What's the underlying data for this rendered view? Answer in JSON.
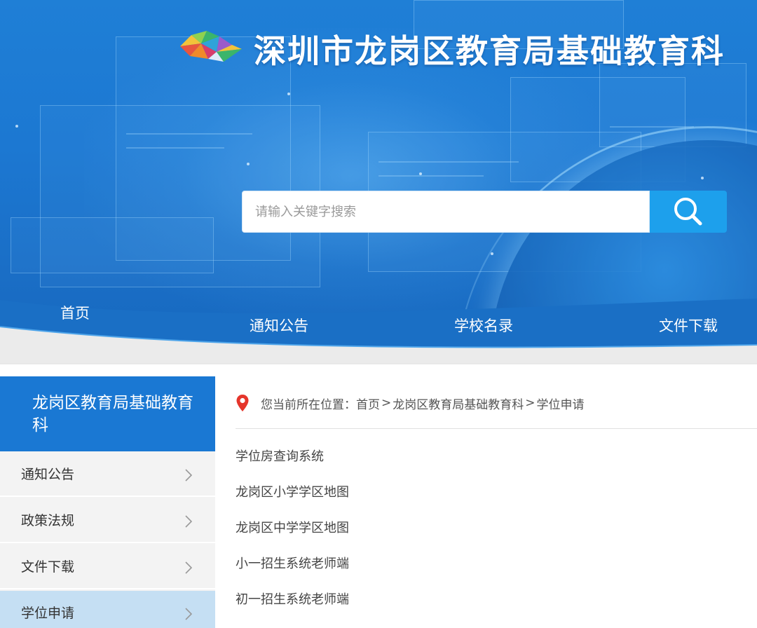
{
  "header": {
    "site_title": "深圳市龙岗区教育局基础教育科",
    "logo_icon": "colorful-polygon-logo"
  },
  "search": {
    "placeholder": "请输入关键字搜索",
    "button_icon": "search-icon",
    "button_color": "#1da0ec"
  },
  "nav": {
    "items": [
      {
        "label": "首页"
      },
      {
        "label": "通知公告"
      },
      {
        "label": "学校名录"
      },
      {
        "label": "文件下载"
      }
    ]
  },
  "sidebar": {
    "title": "龙岗区教育局基础教育科",
    "items": [
      {
        "label": "通知公告",
        "active": false
      },
      {
        "label": "政策法规",
        "active": false
      },
      {
        "label": "文件下载",
        "active": false
      },
      {
        "label": "学位申请",
        "active": true
      }
    ],
    "accent_color": "#1a78d3",
    "active_color": "#c5dff3"
  },
  "breadcrumb": {
    "prefix": "您当前所在位置：",
    "separator": ">",
    "items": [
      "首页",
      "龙岗区教育局基础教育科",
      "学位申请"
    ],
    "icon": "location-pin-icon"
  },
  "main": {
    "links": [
      "学位房查询系统",
      "龙岗区小学学区地图",
      "龙岗区中学学区地图",
      "小一招生系统老师端",
      "初一招生系统老师端"
    ]
  }
}
